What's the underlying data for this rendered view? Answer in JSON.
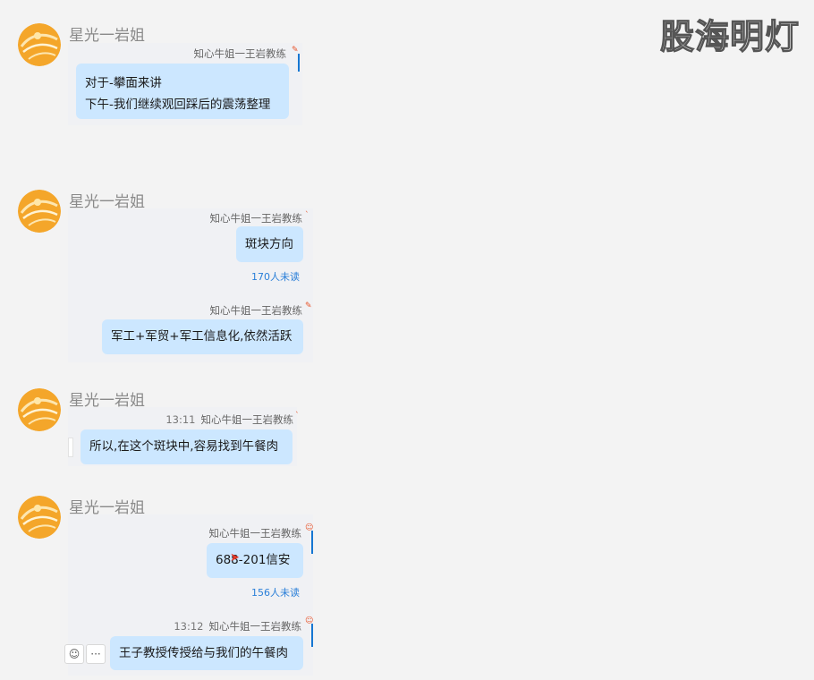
{
  "watermark": "股海明灯",
  "groups": [
    {
      "sender": "星光一岩姐",
      "messages": [
        {
          "author": "知心牛姐一王岩教练",
          "lines": [
            "对于-攀面来讲",
            "下午-我们继续观回踩后的震荡整理"
          ]
        }
      ]
    },
    {
      "sender": "星光一岩姐",
      "messages": [
        {
          "author": "知心牛姐一王岩教练",
          "lines": [
            "斑块方向"
          ],
          "unread": "170人未读"
        },
        {
          "author": "知心牛姐一王岩教练",
          "lines": [
            "军工+军贸+军工信息化,依然活跃"
          ]
        }
      ]
    },
    {
      "sender": "星光一岩姐",
      "messages": [
        {
          "time": "13:11",
          "author": "知心牛姐一王岩教练",
          "lines": [
            "所以,在这个斑块中,容易找到午餐肉"
          ]
        }
      ]
    },
    {
      "sender": "星光一岩姐",
      "messages": [
        {
          "author": "知心牛姐一王岩教练",
          "lines": [
            "688",
            "-201信安"
          ],
          "unread": "156人未读"
        },
        {
          "time": "13:12",
          "author": "知心牛姐一王岩教练",
          "lines": [
            "王子教授传授给与我们的午餐肉"
          ]
        }
      ]
    }
  ],
  "tools": {
    "emoji": "☺",
    "more": "···"
  },
  "colors": {
    "bubble": "#cce7ff",
    "unread": "#2a7fd8",
    "bar": "#1677d2"
  }
}
